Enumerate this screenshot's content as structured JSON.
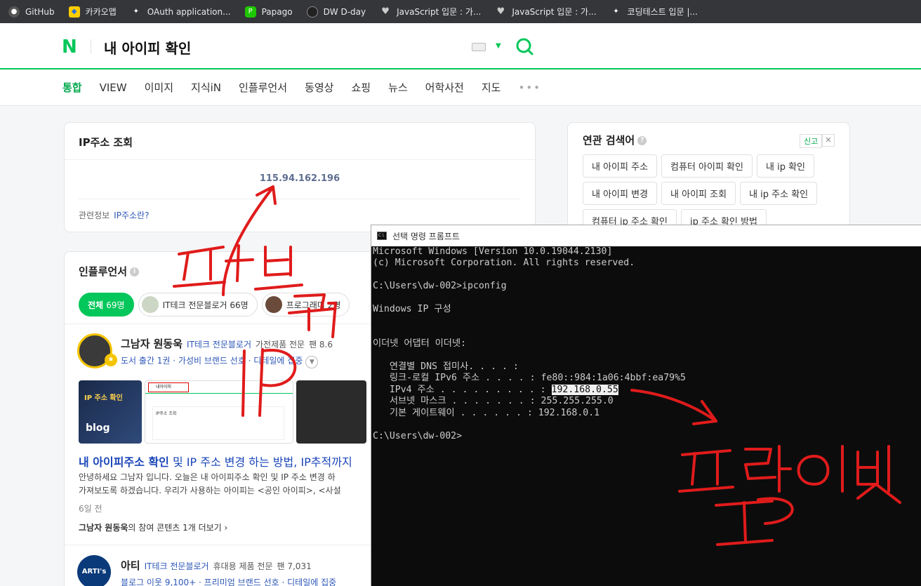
{
  "bookmarks": [
    {
      "label": "GitHub",
      "icon": "github-icon"
    },
    {
      "label": "카카오맵",
      "icon": "kakaomap-icon"
    },
    {
      "label": "OAuth application...",
      "icon": "oauth-icon"
    },
    {
      "label": "Papago",
      "icon": "papago-icon"
    },
    {
      "label": "DW D-day",
      "icon": "dday-icon"
    },
    {
      "label": "JavaScript 입문 : 가...",
      "icon": "heart-icon"
    },
    {
      "label": "JavaScript 입문 : 가...",
      "icon": "heart-icon"
    },
    {
      "label": "코딩테스트 입문 |...",
      "icon": "bookmark-icon"
    }
  ],
  "header": {
    "logo": "N",
    "query": "내 아이피 확인"
  },
  "tabs": [
    "통합",
    "VIEW",
    "이미지",
    "지식iN",
    "인플루언서",
    "동영상",
    "쇼핑",
    "뉴스",
    "어학사전",
    "지도"
  ],
  "tabs_more": "•••",
  "ip_lookup": {
    "title": "IP주소 조회",
    "ip": "115.94.162.196",
    "related_label": "관련정보",
    "related_link": "IP주소란?"
  },
  "influencer": {
    "title": "인플루언서",
    "chips": {
      "all_label": "전체",
      "all_count": "69명",
      "chip2": "IT테크 전문블로거 66명",
      "chip3": "프로그래머 2명"
    },
    "entry1": {
      "name": "그남자 원동욱",
      "category": "IT테크 전문블로거",
      "field": "가전제품 전문",
      "fans": "팬 8.6",
      "sub": "도서 출간 1권 · 가성비 브랜드 선호 · 디테일에 집중"
    },
    "thumb1_title": "IP 주소 확인",
    "thumb1_logo": "blog",
    "thumb2_query": "내아이피",
    "thumb2_box": "IP주소 조회",
    "article": {
      "title_bold": "내 아이피주소 확인",
      "title_rest": " 및 IP 주소 변경 하는 방법, IP추적까지",
      "body1": "안녕하세요 그남자 입니다. 오늘은 내 아이피주소 확인 및 IP 주소 변경 하",
      "body2": "가져보도록 하겠습니다. 우리가 사용하는 아이피는 <공인 아이피>, <사설",
      "date": "6일 전",
      "more_name": "그남자 원동욱",
      "more_rest": "의 참여 콘텐츠 1개 더보기 ›"
    },
    "entry2": {
      "avatar_text": "ARTI's",
      "name": "아티",
      "category": "IT테크 전문블로거",
      "field": "휴대용 제품 전문",
      "fans": "팬 7,031",
      "sub": "블로그 이웃 9,100+ · 프리미엄 브랜드 선호 · 디테일에 집중"
    }
  },
  "related": {
    "title": "연관 검색어",
    "report": "신고",
    "items": [
      "내 아이피 주소",
      "컴퓨터 아이피 확인",
      "내 ip 확인",
      "내 아이피 변경",
      "내 아이피 조회",
      "내 ip 주소 확인",
      "컴퓨터 ip 주소 확인",
      "ip 주소 확인 방법"
    ]
  },
  "cmd": {
    "title": "선택 명령 프롬프트",
    "lines": [
      "Microsoft Windows [Version 10.0.19044.2130]",
      "(c) Microsoft Corporation. All rights reserved.",
      "",
      "C:\\Users\\dw-002>ipconfig",
      "",
      "Windows IP 구성",
      "",
      "",
      "이더넷 어댑터 이더넷:",
      "",
      "   연결별 DNS 접미사. . . . :",
      "   링크-로컬 IPv6 주소 . . . . : fe80::984:1a06:4bbf:ea79%5"
    ],
    "ipv4_label": "   IPv4 주소 . . . . . . . . . : ",
    "ipv4_value": "192.168.0.55",
    "lines_after": [
      "   서브넷 마스크 . . . . . . . : 255.255.255.0",
      "   기본 게이트웨이 . . . . . . : 192.168.0.1",
      "",
      "C:\\Users\\dw-002>"
    ]
  },
  "annotations": {
    "public_ip_label": "퍼블릭 IP",
    "private_ip_label": "프라이빗 IP",
    "ink_color": "#e01b1b"
  }
}
